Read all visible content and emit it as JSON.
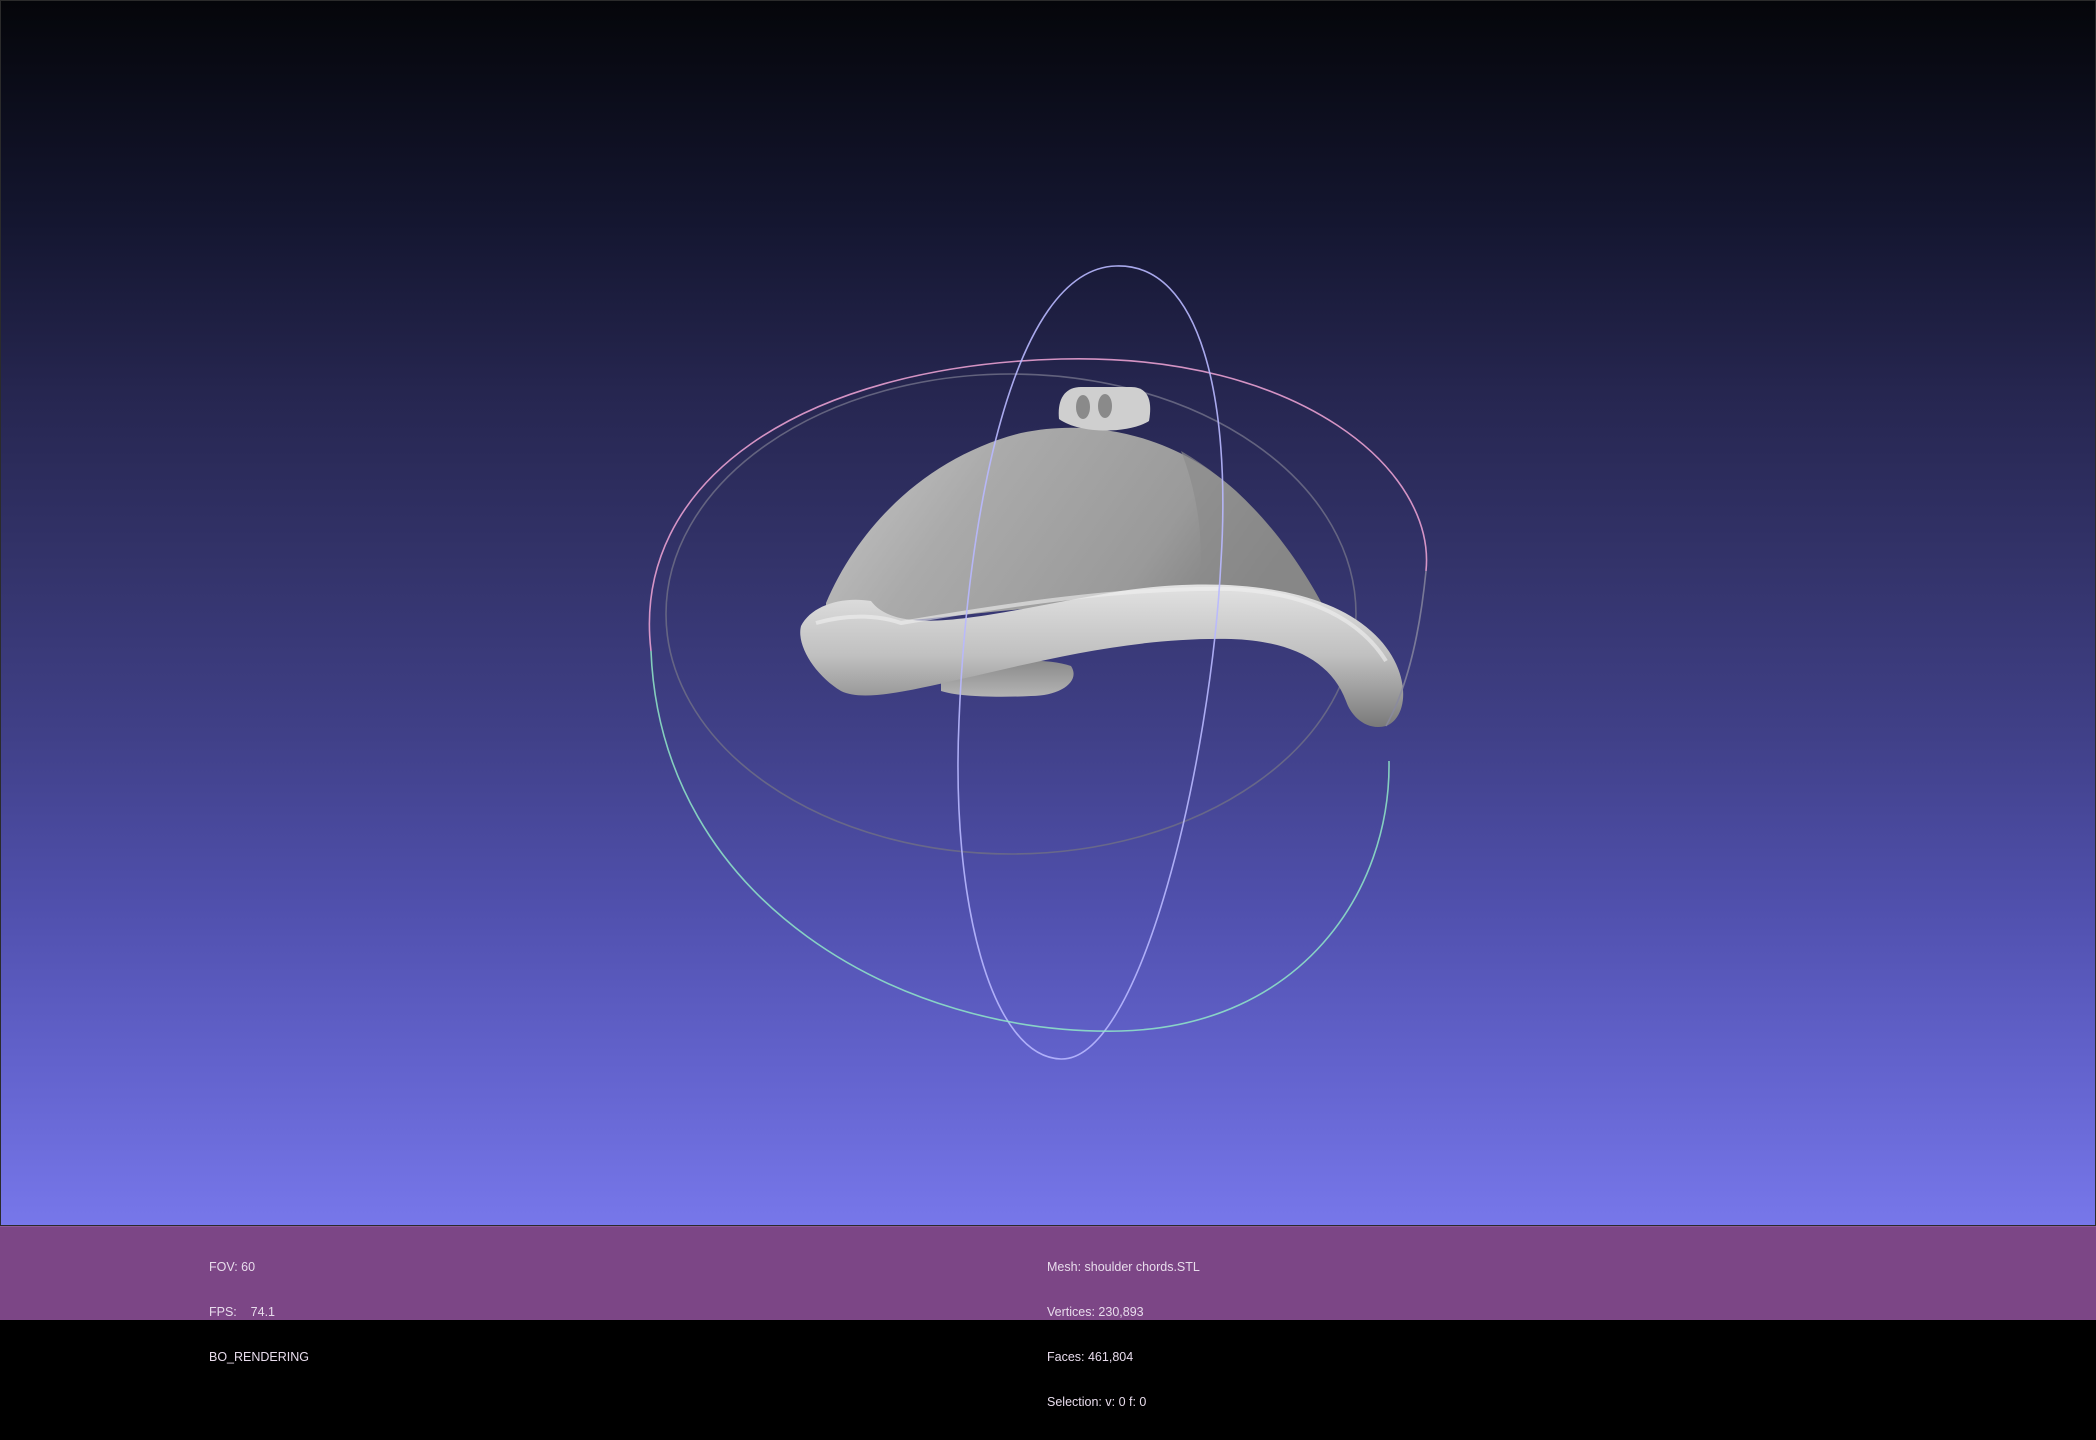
{
  "viewer": {
    "background_top_color": "#05060a",
    "background_bottom_color": "#7777ea",
    "info_bar_color": "#7c4686",
    "text_color": "#e8dcec"
  },
  "scene": {
    "model": "shoulder chords.STL",
    "model_color": "#a9a9a9",
    "trackball": {
      "x_ring_color": "#e8a0d0",
      "y_ring_color": "#b8b8ff",
      "z_ring_color": "#90e8c8"
    }
  },
  "left_info": {
    "fov": "FOV: 60",
    "fps": "FPS:    74.1",
    "mode": "BO_RENDERING"
  },
  "right_info": {
    "mesh": "Mesh: shoulder chords.STL",
    "vertices": "Vertices: 230,893",
    "faces": "Faces: 461,804",
    "selection": "Selection: v: 0 f: 0"
  }
}
